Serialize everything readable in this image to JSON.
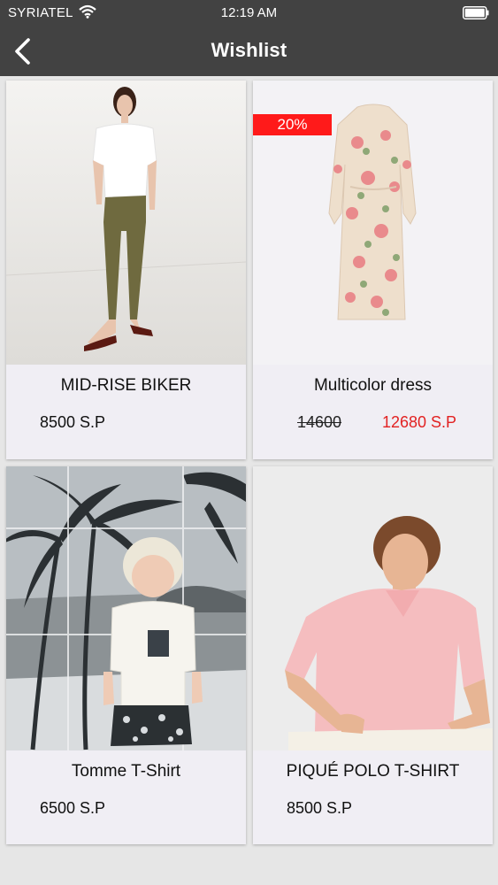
{
  "status_bar": {
    "carrier": "SYRIATEL",
    "time": "12:19 AM"
  },
  "header": {
    "title": "Wishlist",
    "back_icon": "chevron-left-icon"
  },
  "products": [
    {
      "name": "MID-RISE BIKER",
      "price": "8500 S.P"
    },
    {
      "name": "Multicolor dress",
      "old_price": "14600",
      "sale_price": "12680 S.P",
      "discount": "20%"
    },
    {
      "name": "Tomme T-Shirt",
      "price": "6500 S.P"
    },
    {
      "name": "PIQUÉ POLO T-SHIRT",
      "price": "8500 S.P"
    }
  ],
  "colors": {
    "header_bg": "#424242",
    "sale_red": "#e22222",
    "badge_red": "#ff1a1a",
    "card_bg": "#f0eef4"
  }
}
